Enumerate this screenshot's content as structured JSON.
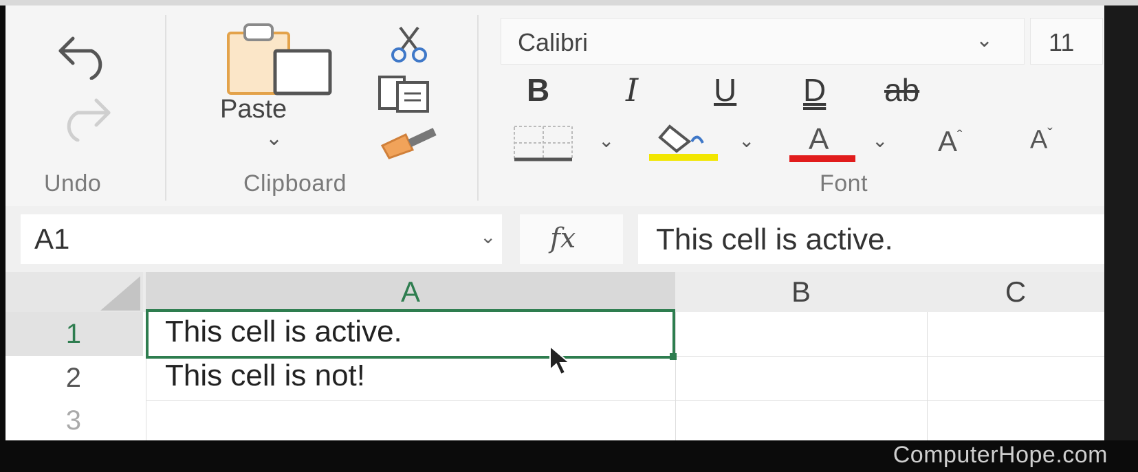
{
  "ribbon": {
    "groups": {
      "undo": {
        "label": "Undo",
        "undo_icon": "undo-arrow-icon",
        "redo_icon": "redo-arrow-icon"
      },
      "clipboard": {
        "label": "Clipboard",
        "paste_label": "Paste",
        "paste_caret": "⌄",
        "cut_icon": "scissors-icon",
        "copy_icon": "copy-icon",
        "format_painter_icon": "paintbrush-icon"
      },
      "font": {
        "label": "Font",
        "font_name": "Calibri",
        "font_caret": "⌄",
        "font_size": "11",
        "bold": "B",
        "italic": "I",
        "underline": "U",
        "double_underline": "D",
        "strikethrough": "ab",
        "font_color_letter": "A",
        "grow_font": "A",
        "shrink_font": "A",
        "fill_color": "#f2e600",
        "font_color": "#e11c1c"
      }
    }
  },
  "formula_bar": {
    "name_box": "A1",
    "name_box_caret": "⌄",
    "fx_label": "fx",
    "formula": "This cell is active."
  },
  "grid": {
    "columns": [
      "A",
      "B",
      "C"
    ],
    "rows": [
      {
        "number": "1",
        "cells": [
          "This cell is active.",
          "",
          ""
        ]
      },
      {
        "number": "2",
        "cells": [
          "This cell is not!",
          "",
          ""
        ]
      }
    ],
    "active_cell": "A1",
    "accent_color": "#2e7d4f"
  },
  "watermark": "ComputerHope.com"
}
